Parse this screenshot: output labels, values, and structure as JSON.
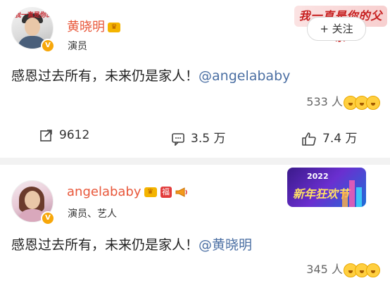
{
  "posts": [
    {
      "username": "黄晓明",
      "subtitle": "演员",
      "avatar_text": "我一直是你的父亲",
      "banner_text": "我一直是你的父亲",
      "follow_label": "+ 关注",
      "content": "感恩过去所有，未来仍是家人！",
      "mention": "@angelababy",
      "reaction_count": "533 人",
      "actions": {
        "share": "9612",
        "comment": "3.5 万",
        "like": "7.4 万"
      }
    },
    {
      "username": "angelababy",
      "subtitle": "演员、艺人",
      "fu_badge": "福",
      "banner_year": "2022",
      "banner_text": "新年狂欢节",
      "content": "感恩过去所有，未来仍是家人！",
      "mention": "@黄晓明",
      "reaction_count": "345 人"
    }
  ],
  "colors": {
    "username": "#e8573a",
    "mention": "#4b6fa3",
    "verified_badge": "#f7a70a"
  },
  "icons": [
    "crown-icon",
    "verified-v-icon",
    "share-icon",
    "comment-icon",
    "like-icon",
    "fu-badge-icon",
    "horn-icon",
    "emoji-icon"
  ]
}
